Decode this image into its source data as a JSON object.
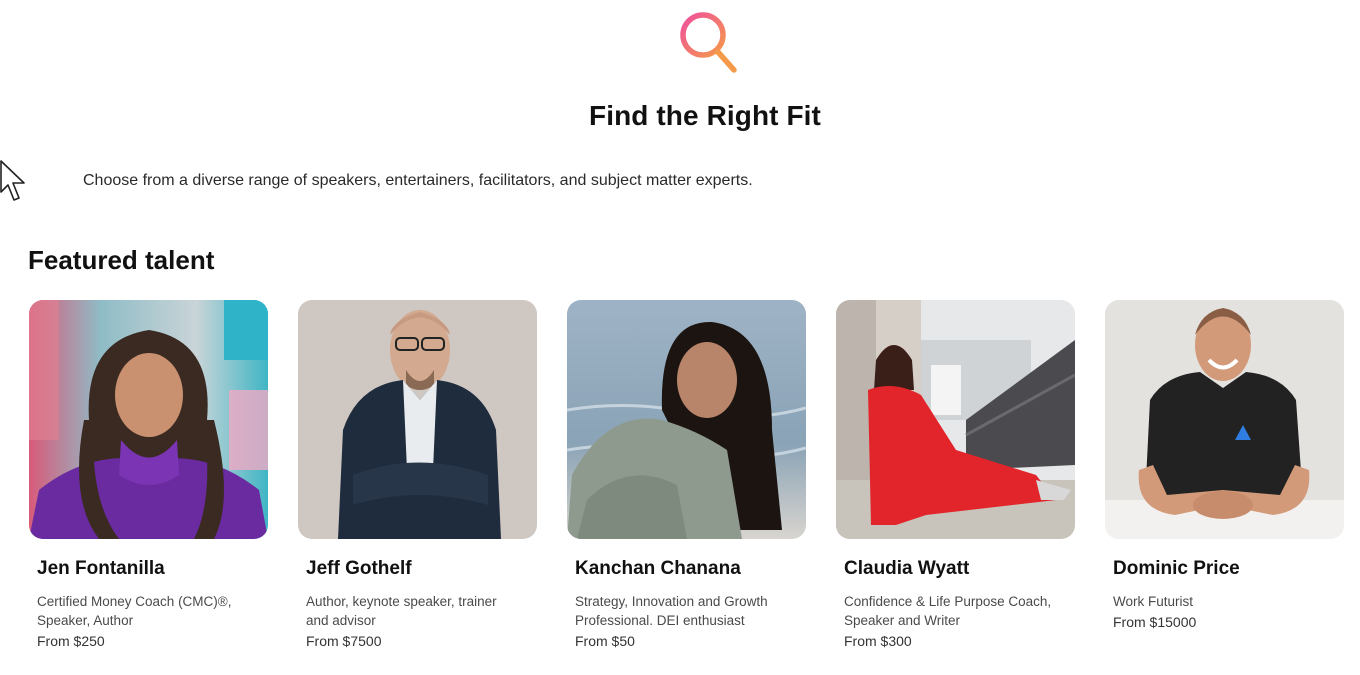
{
  "hero": {
    "icon": "search-icon",
    "title": "Find the Right Fit",
    "description": "Choose from a diverse range of speakers, entertainers, facilitators, and subject matter experts."
  },
  "featured": {
    "title": "Featured talent",
    "cards": [
      {
        "name": "Jen Fontanilla",
        "description": "Certified Money Coach (CMC)®,\nSpeaker, Author",
        "price": "From $250"
      },
      {
        "name": "Jeff Gothelf",
        "description": "Author, keynote speaker, trainer\nand advisor",
        "price": "From $7500"
      },
      {
        "name": "Kanchan Chanana",
        "description": "Strategy, Innovation and Growth\nProfessional. DEI enthusiast",
        "price": "From $50"
      },
      {
        "name": "Claudia Wyatt",
        "description": "Confidence & Life Purpose Coach,\nSpeaker and Writer",
        "price": "From $300"
      },
      {
        "name": "Dominic Price",
        "description": "Work Futurist",
        "price": "From $15000"
      }
    ]
  },
  "colors": {
    "icon_gradient_start": "#f0509c",
    "icon_gradient_end": "#f49a4a"
  }
}
